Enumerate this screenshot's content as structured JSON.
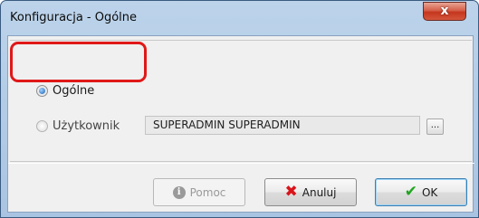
{
  "window": {
    "title": "Konfiguracja - Ogólne",
    "close_glyph": "x"
  },
  "options": {
    "general_label": "Ogólne",
    "general_selected": true,
    "user_label": "Użytkownik",
    "user_selected": false,
    "user_value": "SUPERADMIN SUPERADMIN",
    "browse_label": "..."
  },
  "buttons": {
    "help_label": "Pomoc",
    "cancel_label": "Anuluj",
    "ok_label": "OK"
  },
  "icons": {
    "help": "info-icon",
    "cancel": "x-icon",
    "ok": "checkmark-icon"
  },
  "colors": {
    "highlight": "#e01818",
    "cancel_icon": "#d8141a",
    "ok_icon": "#21a521"
  }
}
